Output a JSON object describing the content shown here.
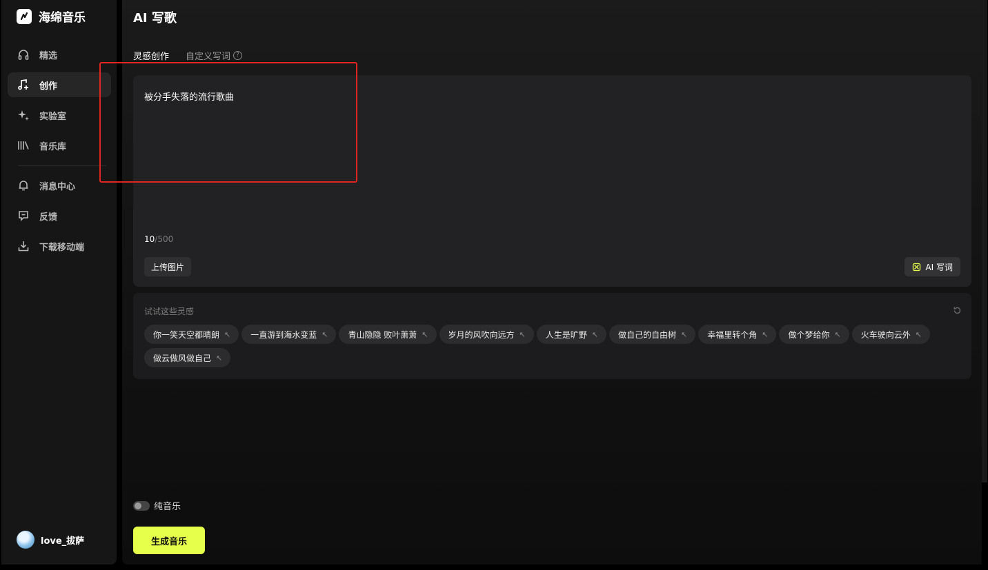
{
  "app": {
    "name": "海绵音乐",
    "logo_icon": "music-note-icon"
  },
  "sidebar": {
    "items": [
      {
        "label": "精选",
        "icon": "headphones-icon",
        "active": false
      },
      {
        "label": "创作",
        "icon": "music-plus-icon",
        "active": true
      },
      {
        "label": "实验室",
        "icon": "sparkle-icon",
        "active": false
      },
      {
        "label": "音乐库",
        "icon": "library-icon",
        "active": false
      },
      {
        "label": "消息中心",
        "icon": "bell-icon",
        "active": false
      },
      {
        "label": "反馈",
        "icon": "feedback-icon",
        "active": false
      },
      {
        "label": "下载移动端",
        "icon": "download-icon",
        "active": false
      }
    ],
    "user": {
      "name": "love_拔萨"
    }
  },
  "main": {
    "title": "AI 写歌",
    "tabs": [
      {
        "label": "灵感创作",
        "active": true
      },
      {
        "label": "自定义写词",
        "active": false
      }
    ],
    "help_glyph": "?",
    "editor": {
      "text": "被分手失落的流行歌曲",
      "count": "10",
      "max": "/500",
      "upload_label": "上传图片",
      "ai_label": "AI 写词"
    },
    "inspiration": {
      "title": "试试这些灵感",
      "chip_arrow": "↖",
      "chips": [
        "你一笑天空都晴朗",
        "一直游到海水变蓝",
        "青山隐隐 败叶萧萧",
        "岁月的风吹向远方",
        "人生是旷野",
        "做自己的自由树",
        "幸福里转个角",
        "做个梦给你",
        "火车驶向云外",
        "做云做风做自己"
      ]
    },
    "toggle": {
      "label": "纯音乐",
      "on": false
    },
    "generate_label": "生成音乐"
  },
  "colors": {
    "accent": "#e6ff4a",
    "annotation": "#e0261f"
  }
}
